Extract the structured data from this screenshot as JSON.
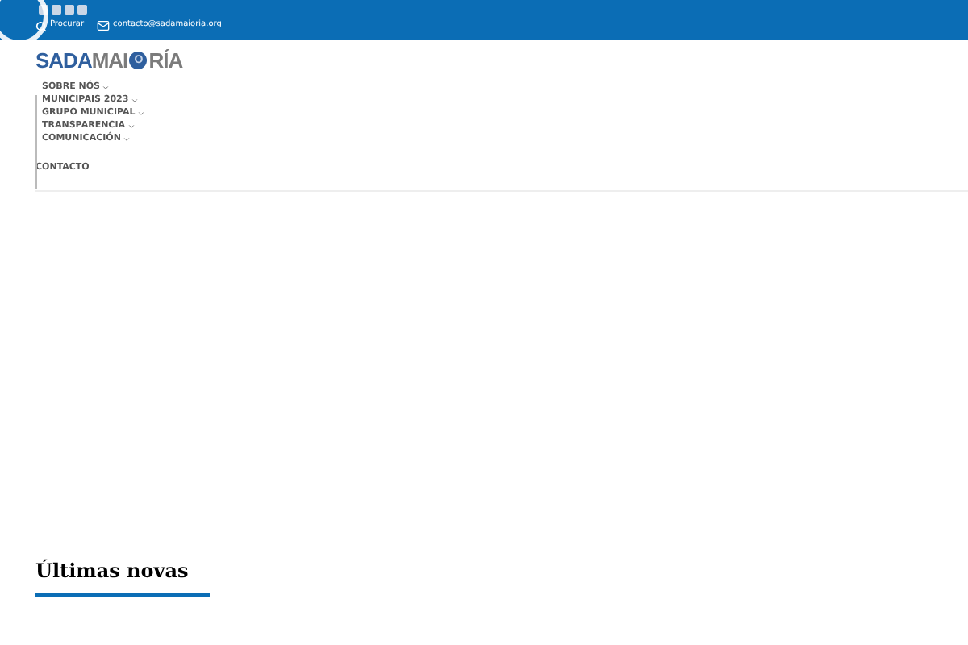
{
  "top_bar": {
    "search": {
      "label": "Procurar"
    },
    "email": "contacto@sadamaioria.org"
  },
  "logo": {
    "parts": [
      {
        "text": "SADA",
        "kind": "primary"
      },
      {
        "text": "MAI",
        "kind": "secondary"
      },
      {
        "text": "O",
        "kind": "ring"
      },
      {
        "text": "RÍA",
        "kind": "secondary"
      }
    ]
  },
  "menu": [
    {
      "label": "SOBRE NÓS",
      "has_submenu": true
    },
    {
      "label": "MUNICIPAIS 2023",
      "has_submenu": true
    },
    {
      "label": "GRUPO MUNICIPAL",
      "has_submenu": true
    },
    {
      "label": "TRANSPARENCIA",
      "has_submenu": true
    },
    {
      "label": "COMUNICACIÓN",
      "has_submenu": true
    }
  ],
  "contact_link": "CONTACTO",
  "section": {
    "title": "Últimas novas"
  }
}
